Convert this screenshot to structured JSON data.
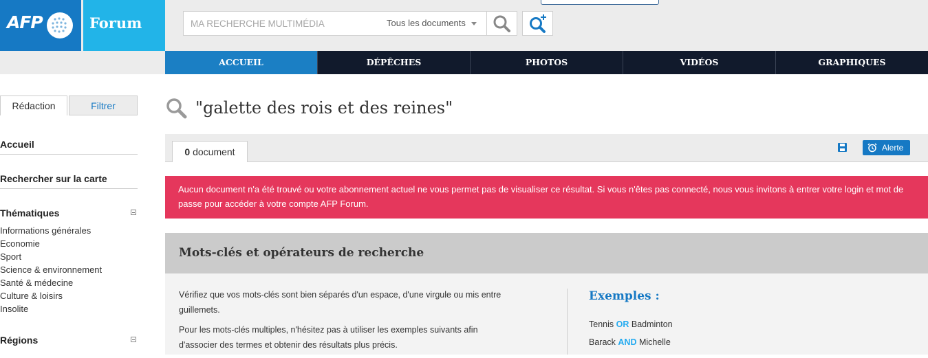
{
  "brand": {
    "afp": "AFP",
    "forum": "Forum",
    "color_primary": "#1679c4",
    "color_secondary": "#22b4e8"
  },
  "search": {
    "placeholder": "MA RECHERCHE MULTIMÉDIA",
    "scope": "Tous les documents"
  },
  "nav": {
    "items": [
      "ACCUEIL",
      "DÉPÊCHES",
      "PHOTOS",
      "VIDÉOS",
      "GRAPHIQUES"
    ],
    "active": "ACCUEIL"
  },
  "sidebar": {
    "tabs": [
      "Rédaction",
      "Filtrer"
    ],
    "links": [
      "Accueil",
      "Rechercher sur la carte"
    ],
    "thematiques": {
      "title": "Thématiques",
      "items": [
        "Informations générales",
        "Economie",
        "Sport",
        "Science & environnement",
        "Santé & médecine",
        "Culture & loisirs",
        "Insolite"
      ]
    },
    "regions": {
      "title": "Régions"
    }
  },
  "results": {
    "query": "\"galette des rois et des reines\"",
    "count": "0",
    "count_label": "document",
    "alert_label": "Alerte",
    "error_message": "Aucun document n'a été trouvé ou votre abonnement actuel ne vous permet pas de visualiser ce résultat. Si vous n'êtes pas connecté, nous vous invitons à entrer votre login et mot de passe pour accéder à votre compte AFP Forum.",
    "error_color": "#e5375c"
  },
  "help": {
    "title": "Mots-clés et opérateurs de recherche",
    "paragraphs": [
      "Vérifiez que vos mots-clés sont bien séparés d'un espace, d'une virgule ou mis entre guillemets.",
      "Pour les mots-clés multiples, n'hésitez pas à utiliser les exemples suivants afin d'associer des termes et obtenir des résultats plus précis."
    ],
    "examples_title": "Exemples :",
    "examples": [
      {
        "a": "Tennis",
        "op": "OR",
        "b": "Badminton"
      },
      {
        "a": "Barack",
        "op": "AND",
        "b": "Michelle"
      }
    ]
  }
}
